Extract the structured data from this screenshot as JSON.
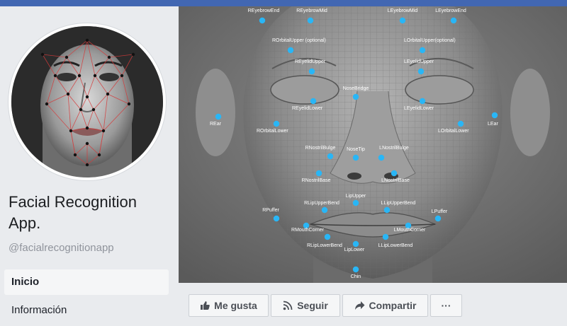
{
  "colors": {
    "topbar": "#4267b2",
    "landmark": "#29b6f6",
    "mesh": "#d63a3a"
  },
  "profile": {
    "name": "Facial Recognition App.",
    "handle": "@facialrecognitionapp"
  },
  "nav": [
    {
      "label": "Inicio",
      "active": true
    },
    {
      "label": "Información",
      "active": false
    }
  ],
  "actions": {
    "like_label": "Me gusta",
    "follow_label": "Seguir",
    "share_label": "Compartir",
    "more_label": "···"
  },
  "cover": {
    "landmarks": [
      "REyebrowEnd",
      "REyebrowMid",
      "LEyebrowMid",
      "LEyebrowEnd",
      "ROrbitalUpper (optional)",
      "LOrbitalUpper(optional)",
      "REyelidUpper",
      "LEyelidUpper",
      "NoseBridge",
      "REyelidLower",
      "LEyelidLower",
      "REar",
      "ROrbitalLower",
      "LOrbitalLower",
      "LEar",
      "RNostrilBulge",
      "NoseTip",
      "LNostrilBulge",
      "RNostrilBase",
      "LNostrilBase",
      "LipUpper",
      "RLipUpperBend",
      "LLipUpperBend",
      "RPuffer",
      "LPuffer",
      "RMouthCorner",
      "LMouthCorner",
      "RLipLowerBend",
      "LipLower",
      "LLipLowerBend",
      "Chin"
    ]
  }
}
